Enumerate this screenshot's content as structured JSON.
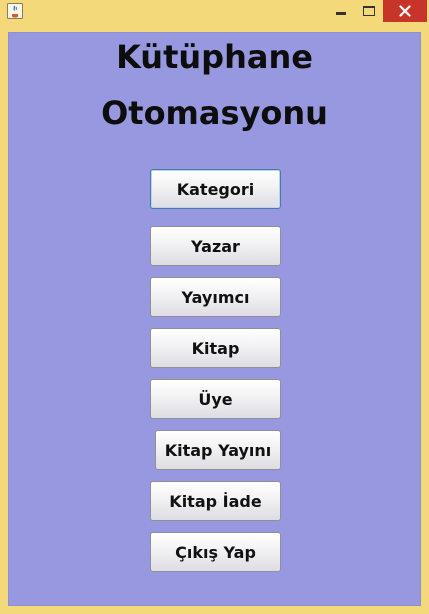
{
  "window": {
    "icon": "java-icon",
    "controls": {
      "minimize": "minimize-icon",
      "maximize": "maximize-icon",
      "close": "close-icon"
    }
  },
  "header": {
    "line1": "Kütüphane",
    "line2": "Otomasyonu"
  },
  "menu": {
    "items": [
      {
        "label": "Kategori"
      },
      {
        "label": "Yazar"
      },
      {
        "label": "Yayımcı"
      },
      {
        "label": "Kitap"
      },
      {
        "label": "Üye"
      },
      {
        "label": "Kitap Yayını"
      },
      {
        "label": "Kitap İade"
      },
      {
        "label": "Çıkış Yap"
      }
    ]
  },
  "colors": {
    "window_frame": "#f4d97a",
    "content_background": "#9898e0",
    "close_button": "#c7342a"
  }
}
